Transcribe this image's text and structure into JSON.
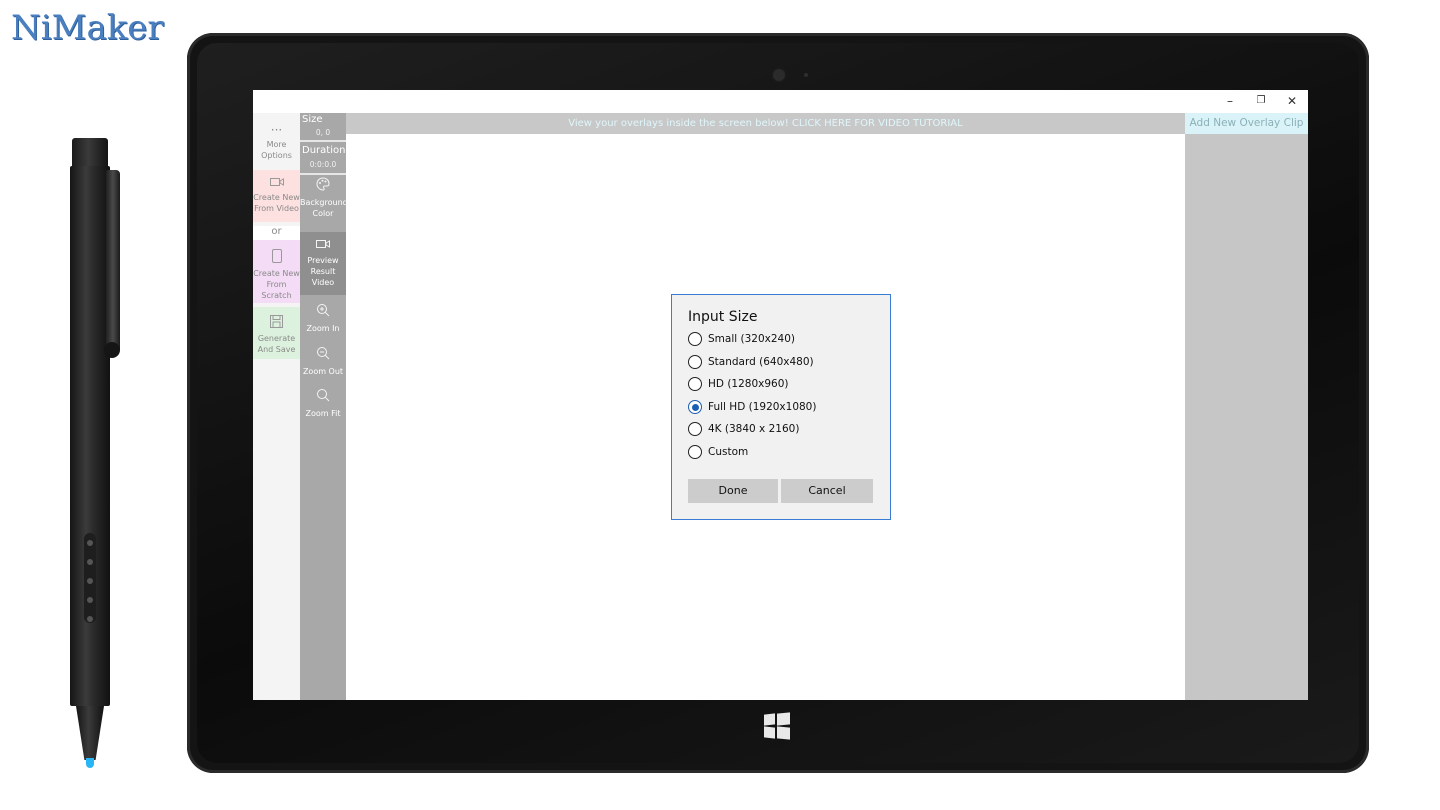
{
  "brand": {
    "name": "NiMaker"
  },
  "window": {
    "minimize": "–",
    "maximize": "❐",
    "close": "✕"
  },
  "left_panel": {
    "more_options": {
      "icon": "···",
      "label": "More Options"
    },
    "create_from_video": {
      "label": "Create New From Video",
      "bg": "#fde0e0"
    },
    "or_label": "or",
    "create_from_scratch": {
      "label": "Create New From Scratch",
      "bg": "#f4dcf6"
    },
    "generate_and_save": {
      "label": "Generate And Save",
      "bg": "#ddf2de"
    }
  },
  "tools": {
    "size_label": "Size",
    "size_value": "0, 0",
    "duration_label": "Duration",
    "duration_value": "0:0:0.0",
    "background_color": "Background Color",
    "preview_result_video": "Preview Result Video",
    "zoom_in": "Zoom In",
    "zoom_out": "Zoom Out",
    "zoom_fit": "Zoom Fit"
  },
  "header": {
    "banner": "View your overlays inside the screen below! CLICK HERE FOR VIDEO TUTORIAL"
  },
  "right_panel": {
    "add_clip": "Add New Overlay Clip"
  },
  "dialog": {
    "title": "Input Size",
    "options": [
      {
        "label": "Small (320x240)",
        "selected": false
      },
      {
        "label": "Standard (640x480)",
        "selected": false
      },
      {
        "label": "HD (1280x960)",
        "selected": false
      },
      {
        "label": "Full HD (1920x1080)",
        "selected": true
      },
      {
        "label": "4K (3840 x 2160)",
        "selected": false
      },
      {
        "label": "Custom",
        "selected": false
      }
    ],
    "done": "Done",
    "cancel": "Cancel"
  },
  "colors": {
    "accent": "#1a5fb4",
    "toolbar": "#a8a8a8",
    "banner_text": "#dff6fb"
  }
}
